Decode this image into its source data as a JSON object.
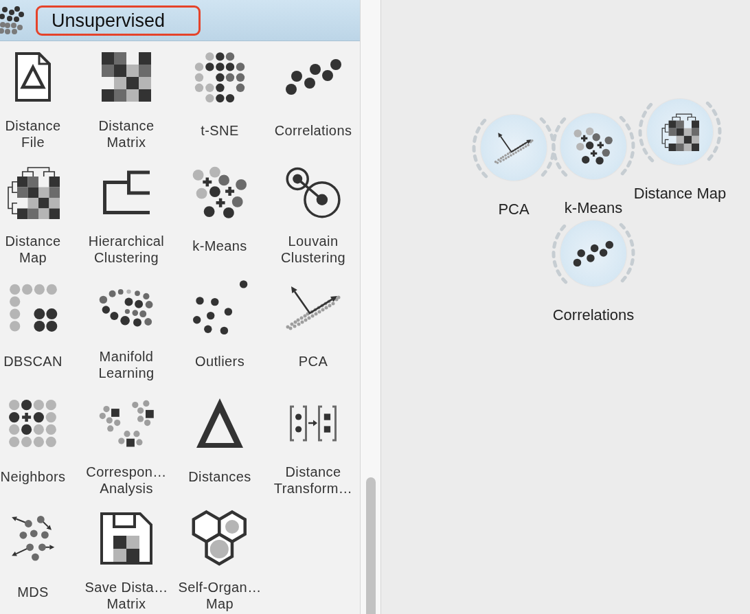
{
  "panel": {
    "category": {
      "title": "Unsupervised",
      "highlighted": true
    },
    "widgets": [
      {
        "label": "Distance\nFile",
        "kind": "distancefile"
      },
      {
        "label": "Distance\nMatrix",
        "kind": "distancematrix"
      },
      {
        "label": "t-SNE",
        "kind": "tsne"
      },
      {
        "label": "Correlations",
        "kind": "correlations"
      },
      {
        "label": "Distance\nMap",
        "kind": "distancemap"
      },
      {
        "label": "Hierarchical\nClustering",
        "kind": "hierarchical"
      },
      {
        "label": "k-Means",
        "kind": "kmeans"
      },
      {
        "label": "Louvain\nClustering",
        "kind": "louvain"
      },
      {
        "label": "DBSCAN",
        "kind": "dbscan"
      },
      {
        "label": "Manifold\nLearning",
        "kind": "manifold"
      },
      {
        "label": "Outliers",
        "kind": "outliers"
      },
      {
        "label": "PCA",
        "kind": "pca"
      },
      {
        "label": "Neighbors",
        "kind": "neighbors"
      },
      {
        "label": "Correspon…\nAnalysis",
        "kind": "correspondence"
      },
      {
        "label": "Distances",
        "kind": "distances"
      },
      {
        "label": "Distance\nTransform…",
        "kind": "transform"
      },
      {
        "label": "MDS",
        "kind": "mds"
      },
      {
        "label": "Save Dista…\nMatrix",
        "kind": "savematrix"
      },
      {
        "label": "Self-Organ…\nMap",
        "kind": "som"
      }
    ]
  },
  "canvas": {
    "nodes": [
      {
        "label": "PCA",
        "kind": "pca"
      },
      {
        "label": "k-Means",
        "kind": "kmeans"
      },
      {
        "label": "Distance Map",
        "kind": "distancemap"
      },
      {
        "label": "Correlations",
        "kind": "correlations"
      }
    ]
  }
}
